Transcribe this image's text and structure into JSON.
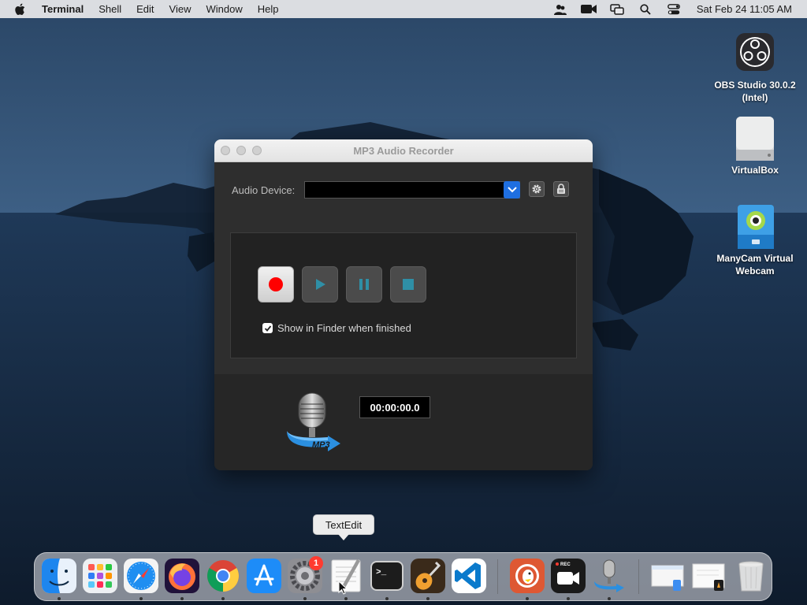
{
  "menubar": {
    "app_name": "Terminal",
    "items": [
      "Shell",
      "Edit",
      "View",
      "Window",
      "Help"
    ],
    "clock": "Sat Feb 24  11:05 AM",
    "status_icons": [
      "user-switch-icon",
      "facetime-camera-icon",
      "screen-mirroring-icon",
      "spotlight-search-icon",
      "control-center-icon"
    ]
  },
  "desktop_icons": [
    {
      "label": "OBS Studio 30.0.2 (Intel)",
      "icon": "obs-studio-icon"
    },
    {
      "label": "VirtualBox",
      "icon": "drive-icon"
    },
    {
      "label": "ManyCam Virtual Webcam",
      "icon": "manycam-icon"
    }
  ],
  "window": {
    "title": "MP3 Audio Recorder",
    "audio_device_label": "Audio Device:",
    "audio_device_value": "",
    "show_in_finder_label": "Show in Finder when finished",
    "show_in_finder_checked": true,
    "timer": "00:00:00.0",
    "logo_text": "MP3"
  },
  "tooltip": "TextEdit",
  "dock": {
    "items": [
      {
        "name": "Finder",
        "icon": "finder-icon",
        "running": true
      },
      {
        "name": "Launchpad",
        "icon": "launchpad-icon",
        "running": false
      },
      {
        "name": "Safari",
        "icon": "safari-icon",
        "running": true
      },
      {
        "name": "Firefox",
        "icon": "firefox-icon",
        "running": true
      },
      {
        "name": "Google Chrome",
        "icon": "chrome-icon",
        "running": true
      },
      {
        "name": "App Store",
        "icon": "app-store-icon",
        "running": false
      },
      {
        "name": "System Preferences",
        "icon": "system-preferences-icon",
        "running": true,
        "badge": "1"
      },
      {
        "name": "TextEdit",
        "icon": "textedit-icon",
        "running": true
      },
      {
        "name": "Terminal",
        "icon": "terminal-icon",
        "running": true
      },
      {
        "name": "GarageBand",
        "icon": "garageband-icon",
        "running": true
      },
      {
        "name": "Visual Studio Code",
        "icon": "vscode-icon",
        "running": false
      },
      {
        "name": "DuckDuckGo",
        "icon": "duckduckgo-icon",
        "running": true
      },
      {
        "name": "Screen Recorder",
        "icon": "screen-recorder-icon",
        "running": true
      },
      {
        "name": "MP3 Audio Recorder",
        "icon": "mp3-recorder-icon",
        "running": true
      },
      {
        "name": "Downloads",
        "icon": "downloads-stack-icon",
        "running": false
      },
      {
        "name": "Documents",
        "icon": "documents-stack-icon",
        "running": false
      },
      {
        "name": "Trash",
        "icon": "trash-icon",
        "running": false
      }
    ],
    "terminal_prompt": ">_",
    "rec_label": "REC"
  },
  "colors": {
    "record_red": "#ff0000",
    "accent_blue": "#1f6fe0",
    "vscode_blue": "#0a7acc"
  }
}
